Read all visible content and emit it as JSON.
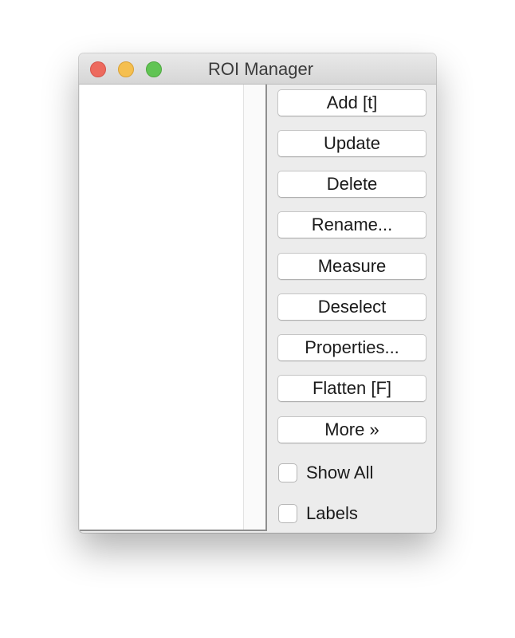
{
  "window": {
    "title": "ROI Manager"
  },
  "buttons": {
    "add": "Add [t]",
    "update": "Update",
    "delete": "Delete",
    "rename": "Rename...",
    "measure": "Measure",
    "deselect": "Deselect",
    "properties": "Properties...",
    "flatten": "Flatten [F]",
    "more": "More »"
  },
  "checkboxes": {
    "show_all": {
      "label": "Show All",
      "checked": false
    },
    "labels": {
      "label": "Labels",
      "checked": false
    }
  },
  "roi_list": {
    "items": []
  }
}
